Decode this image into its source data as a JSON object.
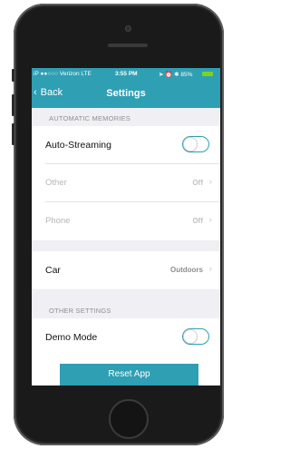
{
  "status_bar": {
    "carrier": "iP ●●○○○ Verizon  LTE",
    "time": "3:55 PM",
    "indicators": "➤ ⏰ ✱ 85%",
    "battery_color": "#7ed321"
  },
  "nav": {
    "back_label": "Back",
    "title": "Settings",
    "accent_color": "#2f9fb3"
  },
  "sections": {
    "automatic_memories": {
      "header": "AUTOMATIC MEMORIES",
      "auto_streaming": {
        "label": "Auto-Streaming",
        "toggle_on": false
      },
      "other": {
        "label": "Other",
        "value": "Off"
      },
      "phone": {
        "label": "Phone",
        "value": "Off"
      }
    },
    "car": {
      "label": "Car",
      "value": "Outdoors"
    },
    "other_settings": {
      "header": "OTHER SETTINGS",
      "demo_mode": {
        "label": "Demo Mode",
        "toggle_on": false
      }
    }
  },
  "reset_button": {
    "label": "Reset App"
  }
}
